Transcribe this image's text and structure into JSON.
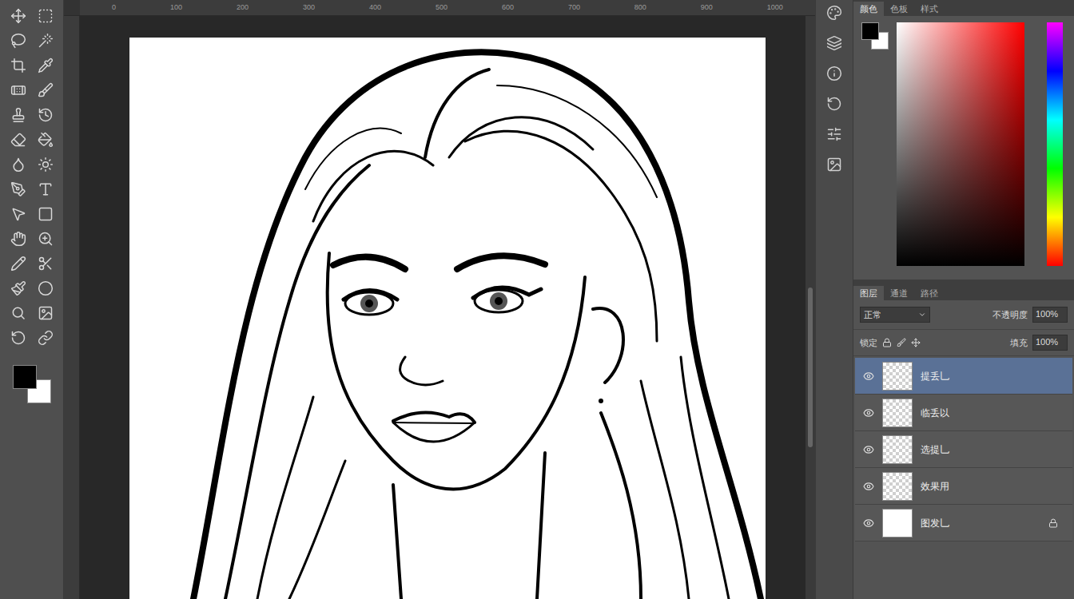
{
  "rulers": {
    "top": [
      "0",
      "100",
      "200",
      "300",
      "400",
      "500",
      "600",
      "700",
      "800",
      "900",
      "1000"
    ]
  },
  "tools": {
    "foreground": "#000000",
    "background": "#ffffff"
  },
  "color_panel": {
    "tabs": [
      {
        "label": "颜色",
        "selected": true
      },
      {
        "label": "色板",
        "selected": false
      },
      {
        "label": "样式",
        "selected": false
      }
    ],
    "foreground": "#000000",
    "background": "#ffffff",
    "hue": "#ff0000"
  },
  "layers_panel": {
    "tabs": [
      {
        "label": "图层",
        "selected": true
      },
      {
        "label": "通道",
        "selected": false
      },
      {
        "label": "路径",
        "selected": false
      }
    ],
    "blend_mode": "正常",
    "opacity_label": "不透明度",
    "opacity": "100%",
    "lock_label": "锁定",
    "fill_label": "填充",
    "fill": "100%",
    "layers": [
      {
        "name": "提丢乚",
        "selected": true,
        "visible": true,
        "kind": "transparent",
        "locked": false
      },
      {
        "name": "临丢以",
        "selected": false,
        "visible": true,
        "kind": "transparent",
        "locked": false
      },
      {
        "name": "选提乚",
        "selected": false,
        "visible": true,
        "kind": "transparent",
        "locked": false
      },
      {
        "name": "效果用",
        "selected": false,
        "visible": true,
        "kind": "transparent",
        "locked": false
      },
      {
        "name": "图发乚",
        "selected": false,
        "visible": true,
        "kind": "background",
        "locked": true
      }
    ]
  }
}
